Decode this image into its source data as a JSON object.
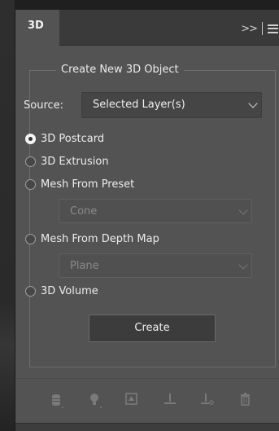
{
  "panel": {
    "tab_title": "3D",
    "collapse_label": ">>"
  },
  "group": {
    "title": "Create New 3D Object"
  },
  "source": {
    "label": "Source:",
    "selected": "Selected Layer(s)"
  },
  "options": [
    {
      "label": "3D Postcard",
      "checked": true
    },
    {
      "label": "3D Extrusion",
      "checked": false
    },
    {
      "label": "Mesh From Preset",
      "checked": false
    },
    {
      "label": "Mesh From Depth Map",
      "checked": false
    },
    {
      "label": "3D Volume",
      "checked": false
    }
  ],
  "preset_select": {
    "selected": "Cone",
    "disabled": true
  },
  "depthmap_select": {
    "selected": "Plane",
    "disabled": true
  },
  "create_button": {
    "label": "Create"
  },
  "footer_icons": [
    "database-icon",
    "light-bulb-icon",
    "camera-view-icon",
    "ground-plane-icon",
    "ground-plane-add-icon",
    "trash-icon"
  ]
}
